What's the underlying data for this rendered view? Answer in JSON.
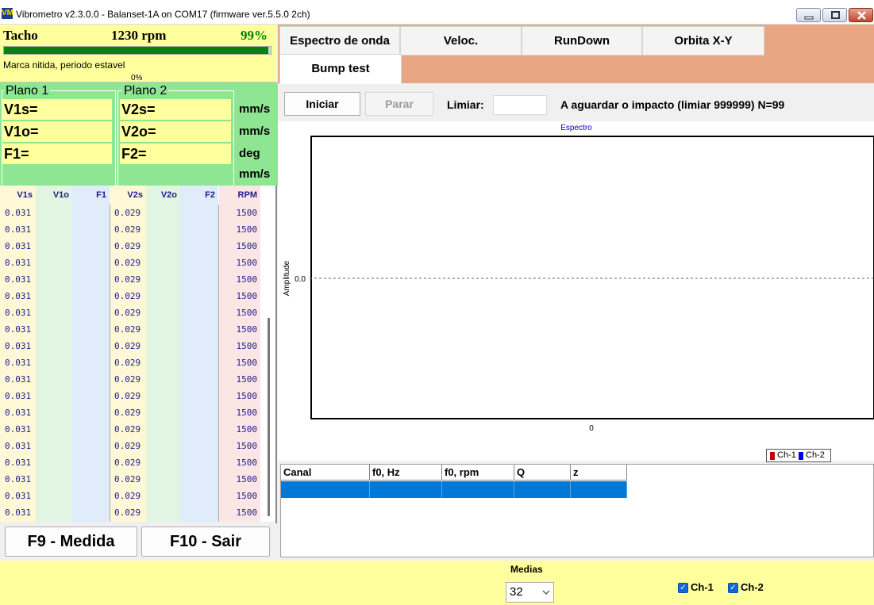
{
  "window": {
    "title": "Vibrometro v2.3.0.0 - Balanset-1A on COM17 (firmware ver.5.5.0 2ch)",
    "icon_text": "VM"
  },
  "tacho": {
    "label": "Tacho",
    "rpm": "1230 rpm",
    "quality": "99%",
    "progress": 0.99,
    "status": "Marca nitida, periodo estavel",
    "progress_min_label": "0%"
  },
  "planes": {
    "plane1": {
      "title": "Plano 1",
      "v1s": "V1s=",
      "v1o": "V1o=",
      "f1": "F1="
    },
    "plane2": {
      "title": "Plano 2",
      "v2s": "V2s=",
      "v2o": "V2o=",
      "f2": "F2="
    },
    "units": [
      "mm/s",
      "mm/s",
      "deg",
      "mm/s"
    ]
  },
  "table": {
    "columns": [
      "V1s",
      "V1o",
      "F1",
      "V2s",
      "V2o",
      "F2",
      "RPM"
    ],
    "rows": [
      [
        "0.031",
        "",
        "",
        "0.029",
        "",
        "",
        "1500"
      ],
      [
        "0.031",
        "",
        "",
        "0.029",
        "",
        "",
        "1500"
      ],
      [
        "0.031",
        "",
        "",
        "0.029",
        "",
        "",
        "1500"
      ],
      [
        "0.031",
        "",
        "",
        "0.029",
        "",
        "",
        "1500"
      ],
      [
        "0.031",
        "",
        "",
        "0.029",
        "",
        "",
        "1500"
      ],
      [
        "0.031",
        "",
        "",
        "0.029",
        "",
        "",
        "1500"
      ],
      [
        "0.031",
        "",
        "",
        "0.029",
        "",
        "",
        "1500"
      ],
      [
        "0.031",
        "",
        "",
        "0.029",
        "",
        "",
        "1500"
      ],
      [
        "0.031",
        "",
        "",
        "0.029",
        "",
        "",
        "1500"
      ],
      [
        "0.031",
        "",
        "",
        "0.029",
        "",
        "",
        "1500"
      ],
      [
        "0.031",
        "",
        "",
        "0.029",
        "",
        "",
        "1500"
      ],
      [
        "0.031",
        "",
        "",
        "0.029",
        "",
        "",
        "1500"
      ],
      [
        "0.031",
        "",
        "",
        "0.029",
        "",
        "",
        "1500"
      ],
      [
        "0.031",
        "",
        "",
        "0.029",
        "",
        "",
        "1500"
      ],
      [
        "0.031",
        "",
        "",
        "0.029",
        "",
        "",
        "1500"
      ],
      [
        "0.031",
        "",
        "",
        "0.029",
        "",
        "",
        "1500"
      ],
      [
        "0.031",
        "",
        "",
        "0.029",
        "",
        "",
        "1500"
      ],
      [
        "0.031",
        "",
        "",
        "0.029",
        "",
        "",
        "1500"
      ],
      [
        "0.031",
        "",
        "",
        "0.029",
        "",
        "",
        "1500"
      ]
    ]
  },
  "buttons": {
    "measure": "F9 - Medida",
    "exit": "F10 - Sair"
  },
  "tabs": [
    "Espectro de onda",
    "Veloc.",
    "RunDown",
    "Orbita X-Y",
    "Bump test"
  ],
  "active_tab": "Bump test",
  "toolbar": {
    "start": "Iniciar",
    "stop": "Parar",
    "threshold_label": "Limiar:",
    "threshold_value": "",
    "status": "A aguardar o impacto (limiar 999999)  N=99"
  },
  "chart": {
    "title": "Espectro",
    "ylabel": "Amplitude",
    "y_tick": "0.0",
    "x_tick": "0"
  },
  "legend": {
    "ch1": "Ch-1",
    "ch2": "Ch-2",
    "ch1_color": "#c00000",
    "ch2_color": "#0000e0"
  },
  "results": {
    "columns": [
      "Canal",
      "f0, Hz",
      "f0, rpm",
      "Q",
      "z"
    ]
  },
  "bottom": {
    "medias_label": "Medias",
    "medias_value": "32",
    "ch1": "Ch-1",
    "ch2": "Ch-2"
  },
  "colors": {
    "yellow": "#ffff9d",
    "green": "#8ee693",
    "tab_bg": "#e8a682",
    "selection": "#0078d7"
  }
}
